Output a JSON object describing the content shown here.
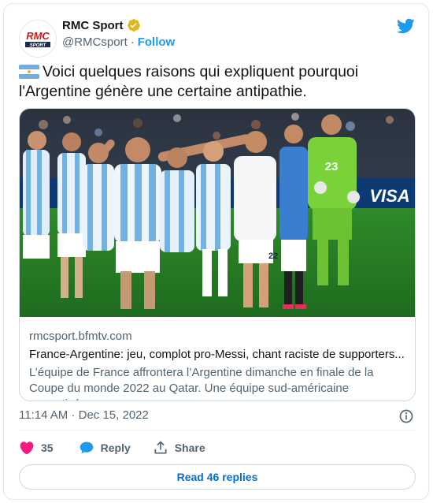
{
  "author": {
    "name": "RMC Sport",
    "handle": "@RMCsport",
    "separator": "·",
    "follow_label": "Follow",
    "avatar_text": "RMC",
    "avatar_subtext": "SPORT"
  },
  "tweet": {
    "text": "Voici quelques raisons qui expliquent pourquoi l'Argentine génère une certaine antipathie."
  },
  "link_card": {
    "domain": "rmcsport.bfmtv.com",
    "title": "France-Argentine: jeu, complot pro-Messi, chant raciste de supporters... ...",
    "description": "L’équipe de France affrontera l’Argentine dimanche en finale de la Coupe du monde 2022 au Qatar. Une équipe sud-américaine surmotivée se ...",
    "image_text": {
      "goalkeeper_number": "23",
      "board_text": "VISA",
      "player_number": "22"
    }
  },
  "meta": {
    "time": "11:14 AM",
    "date_sep": "·",
    "date": "Dec 15, 2022"
  },
  "actions": {
    "likes_count": "35",
    "reply_label": "Reply",
    "share_label": "Share"
  },
  "read_replies_label": "Read 46 replies",
  "colors": {
    "accent": "#1d9bf0",
    "like": "#f91880",
    "link": "#006fd6"
  }
}
